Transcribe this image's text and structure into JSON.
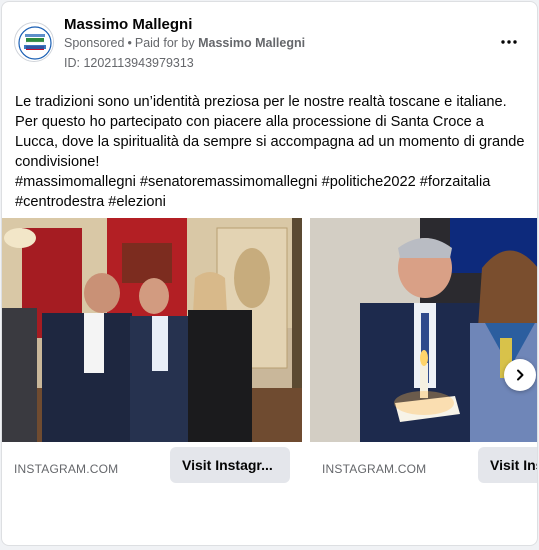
{
  "post": {
    "author": "Massimo Mallegni",
    "sponsored": "Sponsored",
    "paid_for": "Paid for by",
    "paid_by": "Massimo Mallegni",
    "ad_id": "ID: 1202113943979313",
    "text": "Le tradizioni sono un’identità preziosa per le nostre realtà toscane e italiane. Per questo ho partecipato con piacere alla processione di Santa Croce a Lucca, dove la spiritualità da sempre si accompagna ad un momento di grande condivisione!",
    "hashtags": "#massimomallegni #senatoremassimomallegni #politiche2022 #forzaitalia #centrodestra #elezioni",
    "avatar_icon": "forza-italia-logo",
    "more_icon": "more-options-icon"
  },
  "carousel": {
    "cards": [
      {
        "domain": "INSTAGRAM.COM",
        "cta": "Visit Instagr..."
      },
      {
        "domain": "INSTAGRAM.COM",
        "cta": "Visit Ins"
      }
    ],
    "next_icon": "chevron-right-icon"
  }
}
